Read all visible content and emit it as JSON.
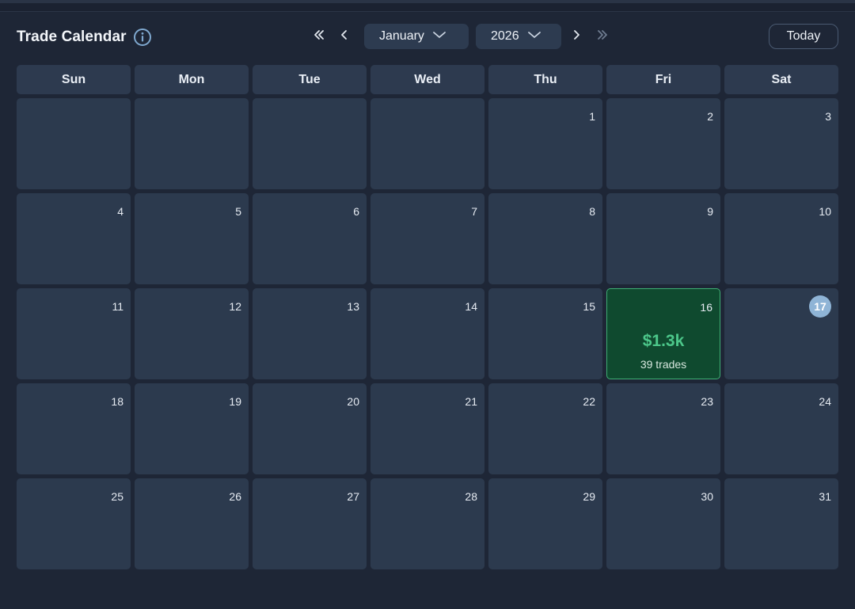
{
  "header": {
    "title": "Trade Calendar",
    "month": "January",
    "year": "2026",
    "today_label": "Today"
  },
  "weekdays": [
    "Sun",
    "Mon",
    "Tue",
    "Wed",
    "Thu",
    "Fri",
    "Sat"
  ],
  "days": [
    {
      "day": ""
    },
    {
      "day": ""
    },
    {
      "day": ""
    },
    {
      "day": ""
    },
    {
      "day": "1"
    },
    {
      "day": "2"
    },
    {
      "day": "3"
    },
    {
      "day": "4"
    },
    {
      "day": "5"
    },
    {
      "day": "6"
    },
    {
      "day": "7"
    },
    {
      "day": "8"
    },
    {
      "day": "9"
    },
    {
      "day": "10"
    },
    {
      "day": "11"
    },
    {
      "day": "12"
    },
    {
      "day": "13"
    },
    {
      "day": "14"
    },
    {
      "day": "15"
    },
    {
      "day": "16",
      "pnl": "$1.3k",
      "trades": "39 trades",
      "status": "profit"
    },
    {
      "day": "17",
      "status": "today"
    },
    {
      "day": "18"
    },
    {
      "day": "19"
    },
    {
      "day": "20"
    },
    {
      "day": "21"
    },
    {
      "day": "22"
    },
    {
      "day": "23"
    },
    {
      "day": "24"
    },
    {
      "day": "25"
    },
    {
      "day": "26"
    },
    {
      "day": "27"
    },
    {
      "day": "28"
    },
    {
      "day": "29"
    },
    {
      "day": "30"
    },
    {
      "day": "31"
    }
  ],
  "icons": {
    "info": "info-icon",
    "first": "double-chevron-left-icon",
    "prev": "chevron-left-icon",
    "next": "chevron-right-icon",
    "last": "double-chevron-right-icon",
    "dropdown": "chevron-down-icon"
  },
  "colors": {
    "background": "#1e2636",
    "cell": "#2c3a4e",
    "profit_cell": "#0f4a2f",
    "profit_border": "#3fae74",
    "profit_text": "#4cc78a",
    "today_badge": "#8fb4d6"
  }
}
